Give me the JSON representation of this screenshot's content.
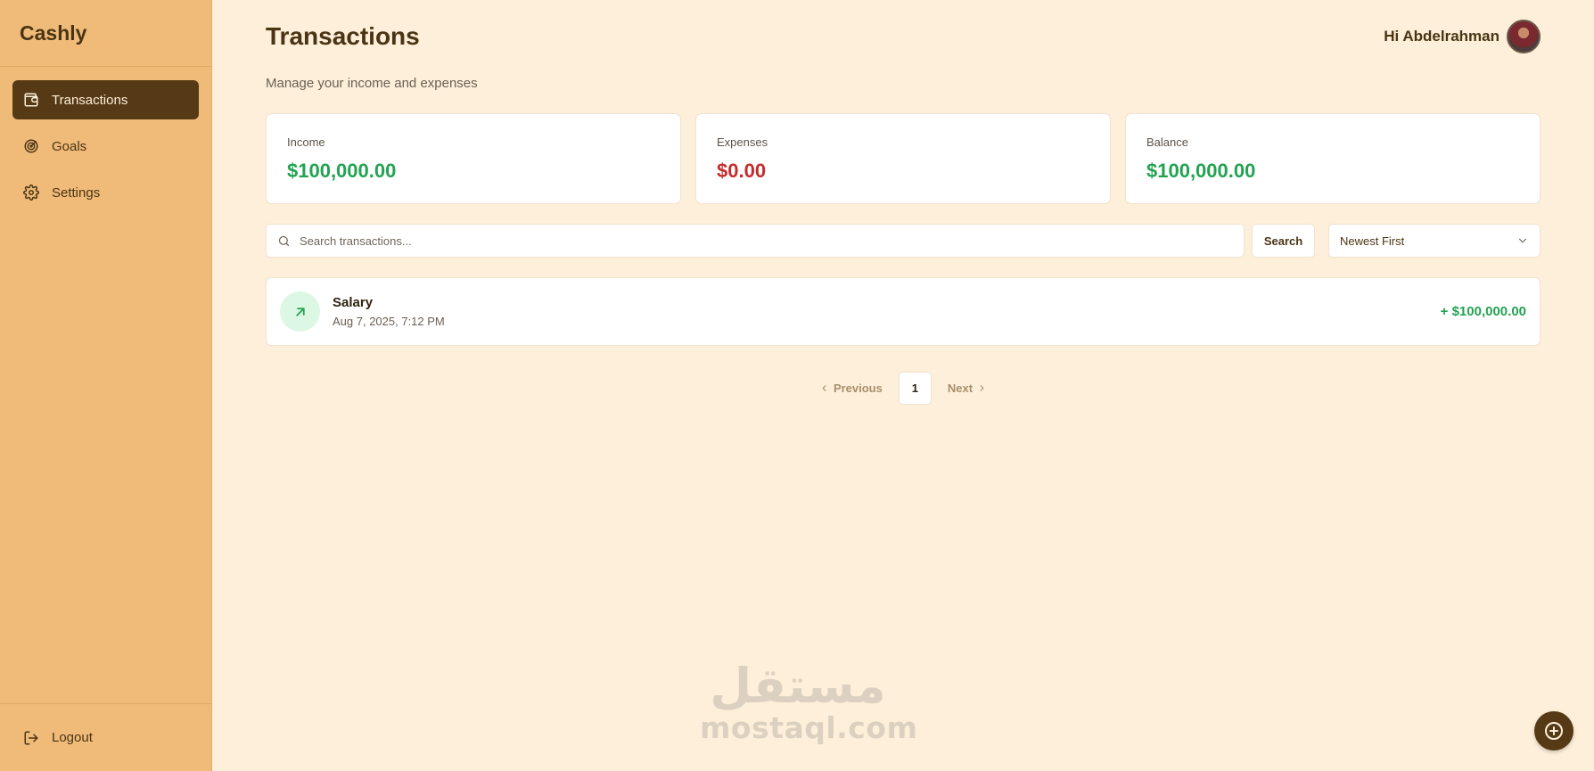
{
  "app": {
    "name": "Cashly"
  },
  "sidebar": {
    "items": [
      {
        "label": "Transactions",
        "icon": "wallet-icon",
        "active": true
      },
      {
        "label": "Goals",
        "icon": "target-icon",
        "active": false
      },
      {
        "label": "Settings",
        "icon": "gear-icon",
        "active": false
      }
    ],
    "logout_label": "Logout"
  },
  "header": {
    "title": "Transactions",
    "subtitle": "Manage your income and expenses",
    "greeting": "Hi Abdelrahman"
  },
  "summary": {
    "income": {
      "label": "Income",
      "value": "$100,000.00"
    },
    "expenses": {
      "label": "Expenses",
      "value": "$0.00"
    },
    "balance": {
      "label": "Balance",
      "value": "$100,000.00"
    }
  },
  "search": {
    "placeholder": "Search transactions...",
    "value": "",
    "button_label": "Search"
  },
  "sort": {
    "selected": "Newest First"
  },
  "transactions": [
    {
      "title": "Salary",
      "date": "Aug 7, 2025, 7:12 PM",
      "amount": "+ $100,000.00",
      "type": "income"
    }
  ],
  "pagination": {
    "previous_label": "Previous",
    "current_page": "1",
    "next_label": "Next"
  },
  "watermark": {
    "arabic": "مستقل",
    "latin": "mostaql.com"
  },
  "colors": {
    "sidebar_bg": "#f0bb79",
    "page_bg": "#fdefd9",
    "active_nav": "#563a16",
    "positive": "#23a352",
    "negative": "#c52c2c"
  }
}
